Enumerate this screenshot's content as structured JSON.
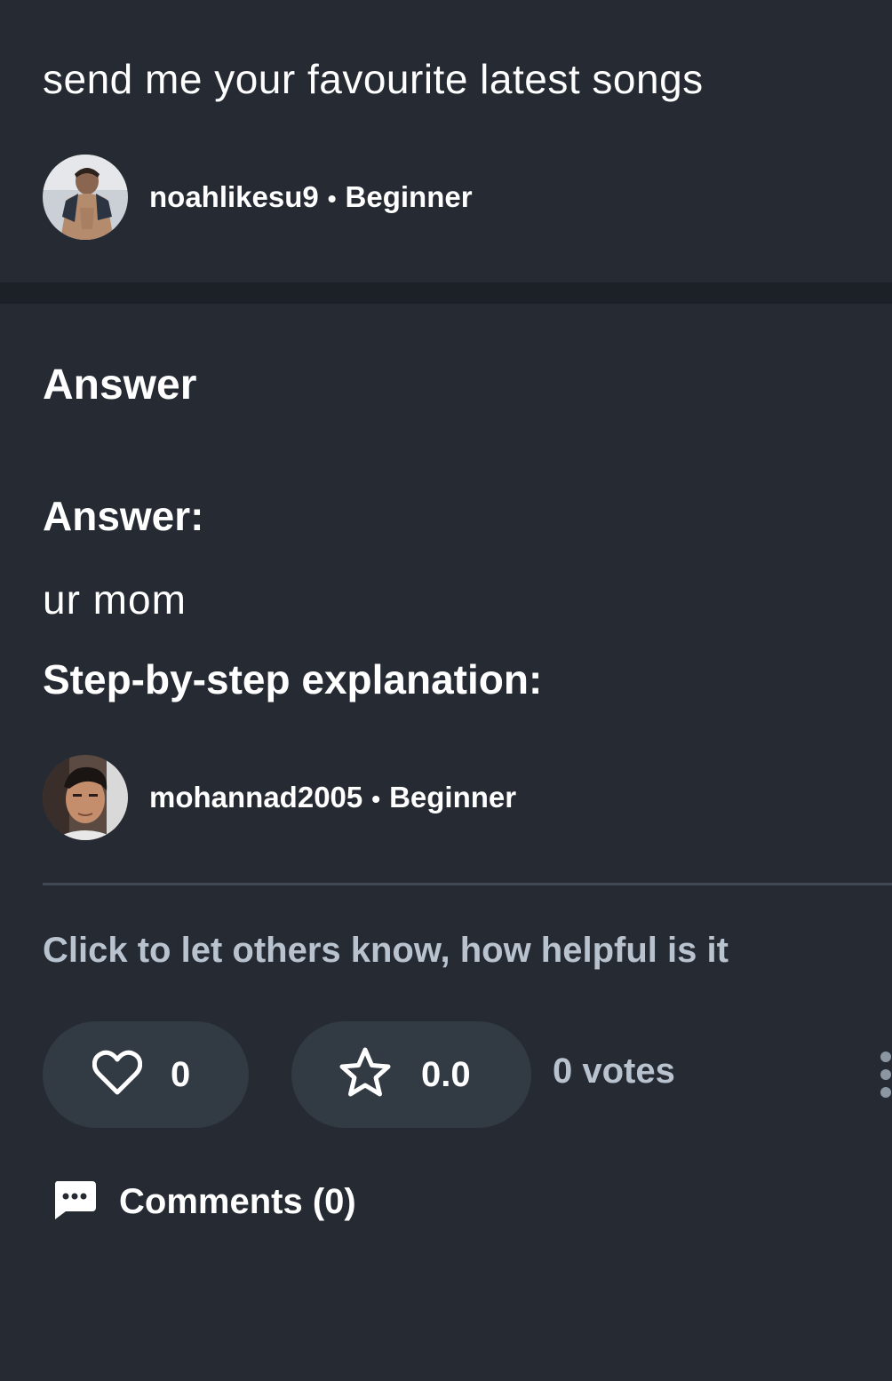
{
  "question": {
    "title": "send me your favourite latest songs",
    "author": {
      "username": "noahlikesu9",
      "separator": "•",
      "rank": "Beginner"
    }
  },
  "answer": {
    "heading": "Answer",
    "answer_label": "Answer:",
    "answer_text": "ur mom",
    "explanation_label": "Step-by-step explanation:",
    "author": {
      "username": "mohannad2005",
      "separator": "•",
      "rank": "Beginner"
    },
    "helpful_prompt": "Click to let others know, how helpful is it",
    "likes": "0",
    "rating": "0.0",
    "votes": "0 votes",
    "comments_label": "Comments (0)"
  },
  "icons": {
    "like": "heart-icon",
    "rate": "star-icon",
    "more": "more-vertical-icon",
    "comments": "comment-bubble-icon"
  },
  "colors": {
    "background": "#252a33",
    "band": "#1c2027",
    "pill": "#323a44",
    "muted_text": "#b9c3cf",
    "divider": "#414955"
  }
}
